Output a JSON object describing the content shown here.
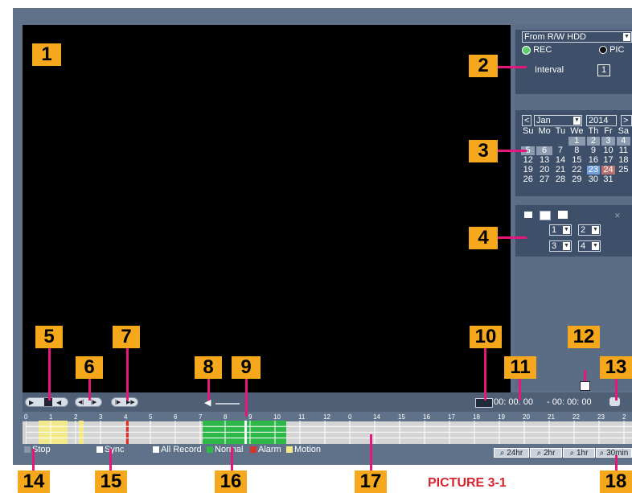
{
  "source_select": "From R/W HDD",
  "rec_label": "REC",
  "pic_label": "PIC",
  "interval_label": "Interval",
  "interval_value": "1",
  "calendar": {
    "month": "Jan",
    "year": "2014",
    "prev": "<",
    "next": ">",
    "weekdays": [
      "Su",
      "Mo",
      "Tu",
      "We",
      "Th",
      "Fr",
      "Sa"
    ],
    "rows": [
      [
        "",
        "",
        "",
        "1",
        "2",
        "3",
        "4",
        "5",
        "6",
        "7"
      ],
      [
        "8",
        "9",
        "10",
        "11",
        "12",
        "13",
        "14"
      ],
      [
        "15",
        "16",
        "17",
        "18",
        "19",
        "20",
        "21"
      ],
      [
        "22",
        "23",
        "24",
        "25",
        "26",
        "27",
        "28"
      ],
      [
        "29",
        "30",
        "31"
      ]
    ]
  },
  "channels": [
    "1",
    "2",
    "3",
    "4"
  ],
  "time_start": "00: 00: 00",
  "time_sep": "- 00: 00: 00",
  "timeline_ticks": [
    "0",
    "1",
    "2",
    "3",
    "4",
    "5",
    "6",
    "7",
    "8",
    "9",
    "10",
    "11",
    "12",
    "0",
    "14",
    "15",
    "16",
    "17",
    "18",
    "19",
    "20",
    "21",
    "22",
    "23",
    "2"
  ],
  "legend": {
    "stop": "Stop",
    "sync": "Sync",
    "all_record": "All Record",
    "normal": "Normal",
    "alarm": "Alarm",
    "motion": "Motion"
  },
  "zoom": [
    "24hr",
    "2hr",
    "1hr",
    "30min"
  ],
  "callouts": [
    "1",
    "2",
    "3",
    "4",
    "5",
    "6",
    "7",
    "8",
    "9",
    "10",
    "11",
    "12",
    "13",
    "14",
    "15",
    "16",
    "17",
    "18"
  ],
  "caption": "PICTURE 3-1",
  "colors": {
    "callout": "#f5a81c",
    "pointer": "#e6177a",
    "normal": "#2eb84a",
    "motion": "#f2ea8a",
    "alarm": "#d8342b"
  }
}
